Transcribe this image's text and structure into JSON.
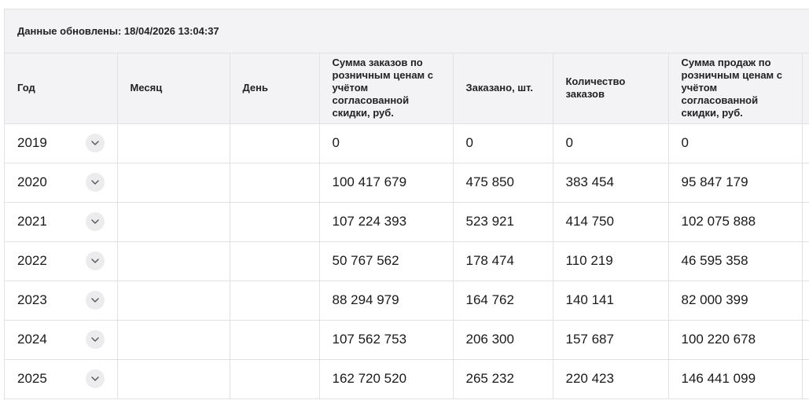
{
  "updated_label": "Данные обновлены: 18/04/2026 13:04:37",
  "columns": [
    "Год",
    "Месяц",
    "День",
    "Сумма заказов по розничным ценам с учётом согласованной скидки, руб.",
    "Заказано, шт.",
    "Количество заказов",
    "Сумма продаж по розничным ценам с учётом согласованной скидки, руб.",
    ""
  ],
  "rows": [
    {
      "year": "2019",
      "month": "",
      "day": "",
      "orders_sum": "0",
      "ordered_qty": "0",
      "orders_count": "0",
      "sales_sum": "0"
    },
    {
      "year": "2020",
      "month": "",
      "day": "",
      "orders_sum": "100 417 679",
      "ordered_qty": "475 850",
      "orders_count": "383 454",
      "sales_sum": "95 847 179"
    },
    {
      "year": "2021",
      "month": "",
      "day": "",
      "orders_sum": "107 224 393",
      "ordered_qty": "523 921",
      "orders_count": "414 750",
      "sales_sum": "102 075 888"
    },
    {
      "year": "2022",
      "month": "",
      "day": "",
      "orders_sum": "50 767 562",
      "ordered_qty": "178 474",
      "orders_count": "110 219",
      "sales_sum": "46 595 358"
    },
    {
      "year": "2023",
      "month": "",
      "day": "",
      "orders_sum": "88 294 979",
      "ordered_qty": "164 762",
      "orders_count": "140 141",
      "sales_sum": "82 000 399"
    },
    {
      "year": "2024",
      "month": "",
      "day": "",
      "orders_sum": "107 562 753",
      "ordered_qty": "206 300",
      "orders_count": "157 687",
      "sales_sum": "100 220 678"
    },
    {
      "year": "2025",
      "month": "",
      "day": "",
      "orders_sum": "162 720 520",
      "ordered_qty": "265 232",
      "orders_count": "220 423",
      "sales_sum": "146 441 099"
    }
  ],
  "icons": {
    "expand": "chevron-down-icon"
  }
}
